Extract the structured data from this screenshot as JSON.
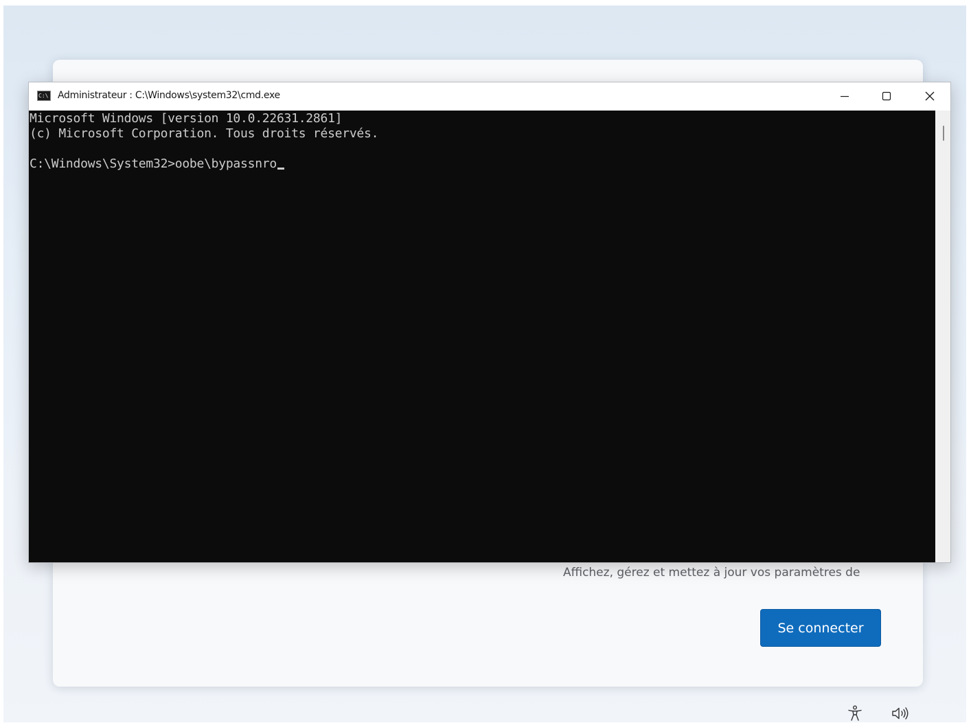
{
  "window": {
    "title": "Administrateur : C:\\Windows\\system32\\cmd.exe",
    "icon_text": "C:\\",
    "controls": [
      "minimize-icon",
      "maximize-icon",
      "close-icon"
    ]
  },
  "console": {
    "lines": [
      "Microsoft Windows [version 10.0.22631.2861]",
      "(c) Microsoft Corporation. Tous droits réservés.",
      "",
      "C:\\Windows\\System32>oobe\\bypassnro"
    ]
  },
  "oobe": {
    "description": "Affichez, gérez et mettez à jour vos paramètres de",
    "signin_label": "Se connecter"
  },
  "tray": {
    "icons": [
      "accessibility-icon",
      "volume-icon"
    ]
  },
  "colors": {
    "console_bg": "#0c0c0c",
    "console_fg": "#cccccc",
    "accent": "#0f6cbd"
  }
}
